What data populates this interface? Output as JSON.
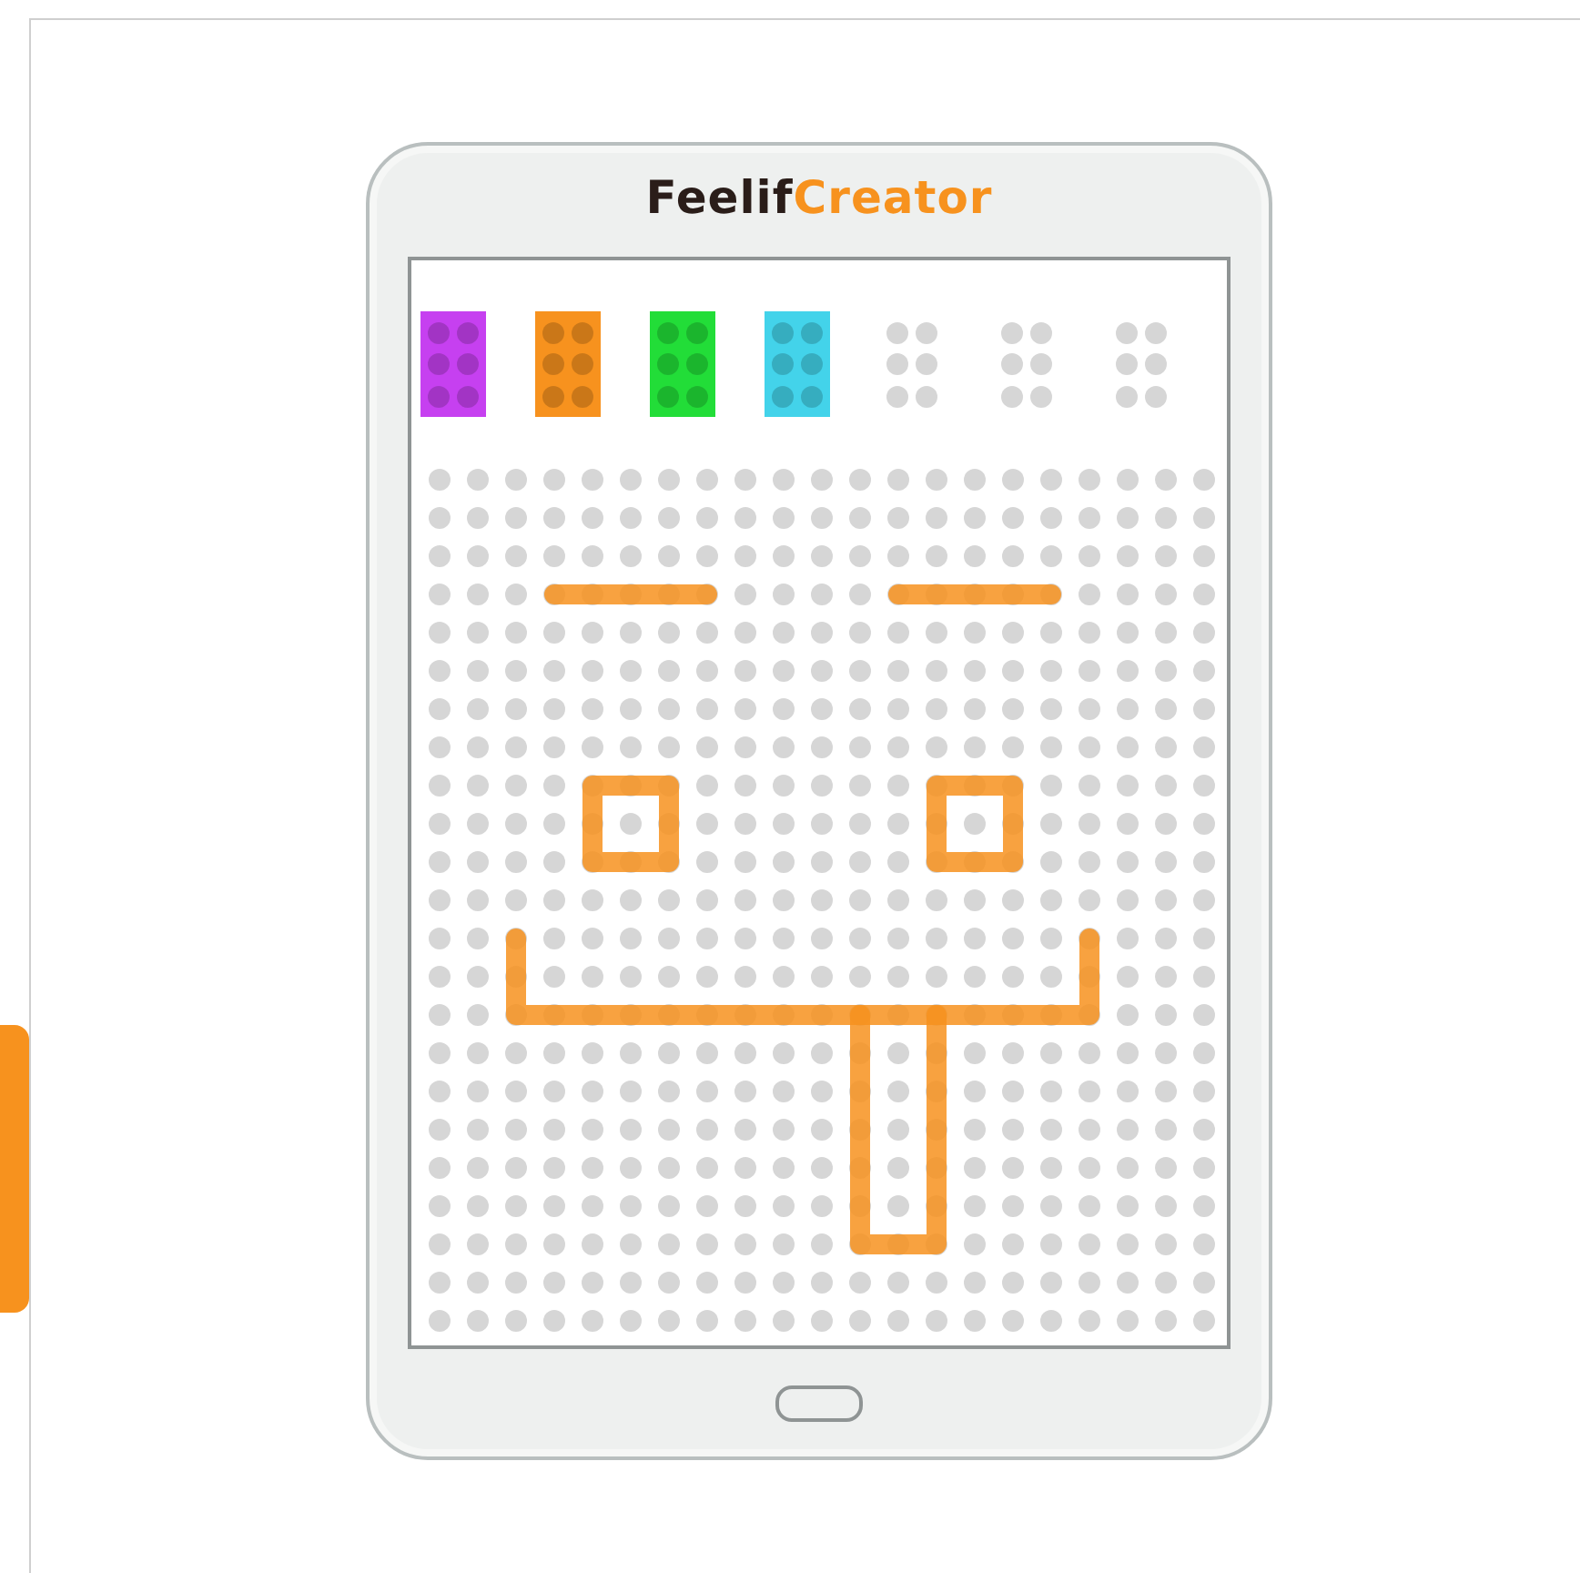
{
  "app_title": {
    "parts": [
      {
        "text": "Feelif",
        "color": "#2a1d19"
      },
      {
        "text": "Creator",
        "color": "#f7921e"
      }
    ]
  },
  "palette": [
    {
      "kind": "color",
      "color": "#c640f0"
    },
    {
      "kind": "color",
      "color": "#f7921e"
    },
    {
      "kind": "color",
      "color": "#22dd38"
    },
    {
      "kind": "color",
      "color": "#43d3ea"
    },
    {
      "kind": "empty"
    },
    {
      "kind": "empty"
    },
    {
      "kind": "empty"
    }
  ]
}
